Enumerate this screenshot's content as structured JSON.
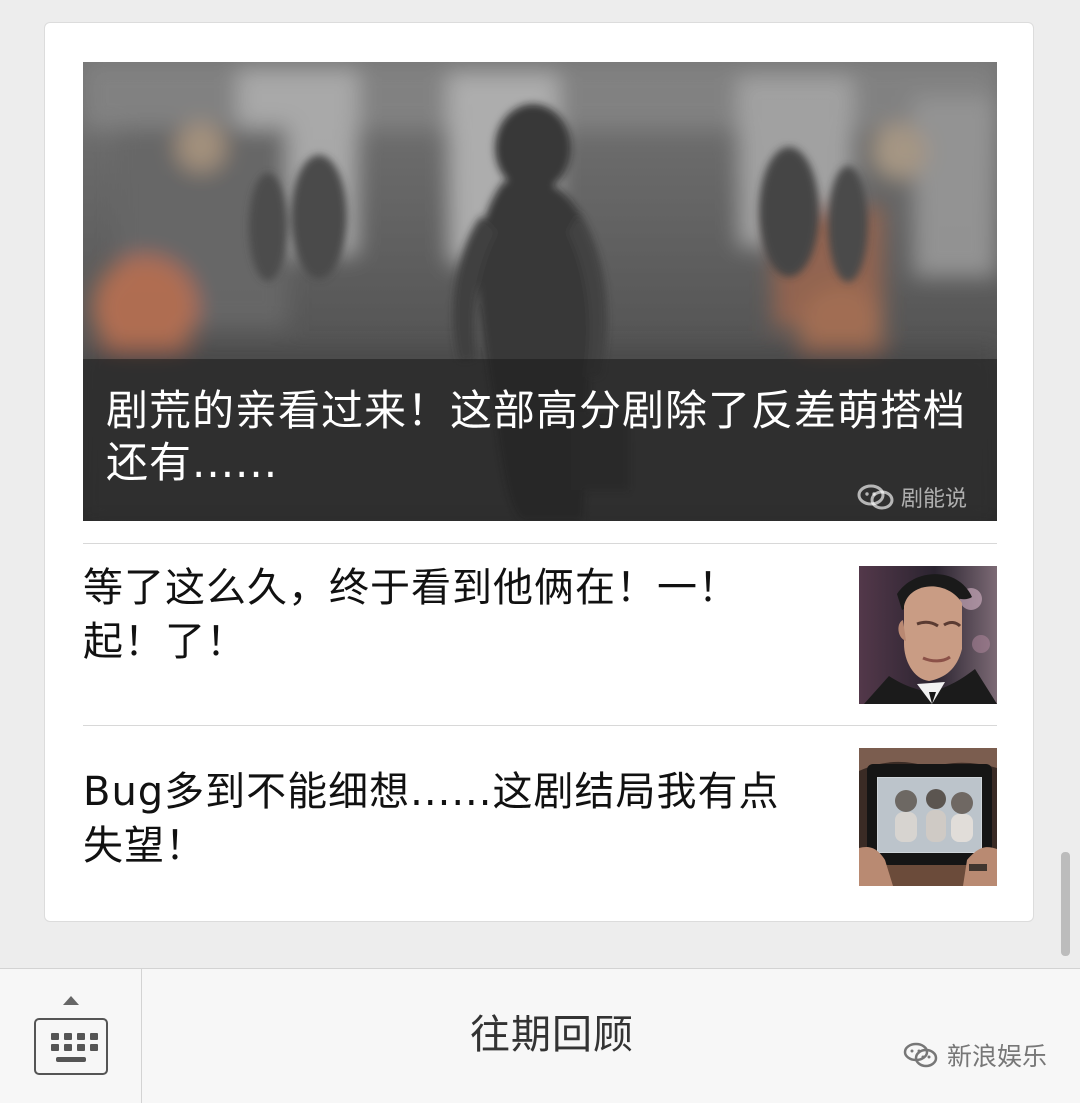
{
  "featured_article": {
    "title": "剧荒的亲看过来！这部高分剧除了反差萌搭档还有......",
    "watermark": "剧能说"
  },
  "articles": [
    {
      "title": "等了这么久，终于看到他俩在！一！起！了！",
      "thumbnail": "portrait-icon"
    },
    {
      "title": "Bug多到不能细想......这剧结局我有点失望！",
      "thumbnail": "tablet-photo-icon"
    }
  ],
  "bottom_menu": {
    "label": "往期回顾",
    "brand_watermark": "新浪娱乐",
    "keyboard_icon": "keyboard-icon",
    "expand_icon": "chevron-up-icon"
  },
  "colors": {
    "page_background": "#ededed",
    "card_background": "#ffffff",
    "text_primary": "#111111",
    "menu_text": "#333333"
  }
}
